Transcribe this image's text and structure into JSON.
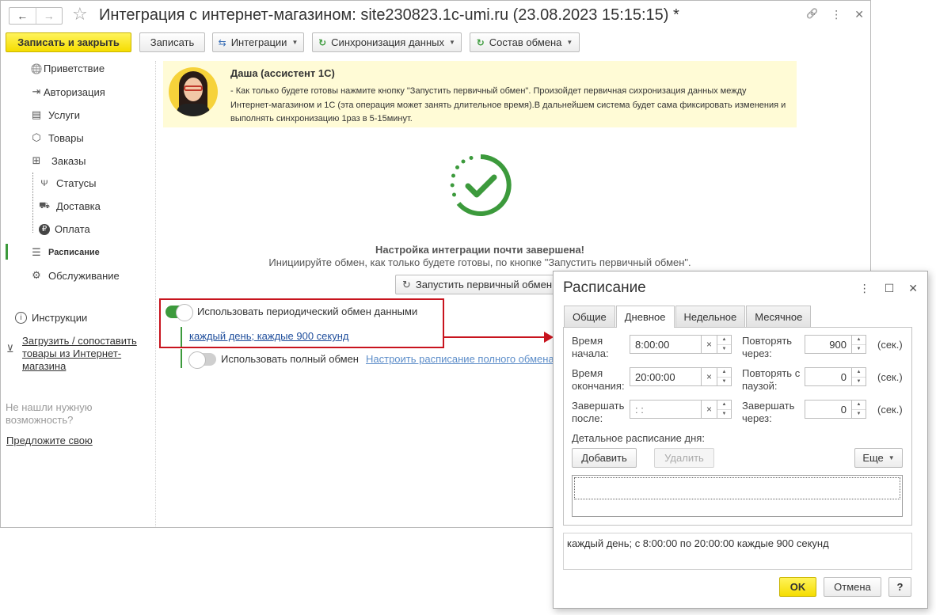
{
  "window": {
    "title": "Интеграция с интернет-магазином: site230823.1c-umi.ru (23.08.2023 15:15:15) *",
    "back_glyph": "←",
    "forward_glyph": "→",
    "star_glyph": "☆",
    "link_glyph": "🔗",
    "more_glyph": "⋮",
    "close_glyph": "✕"
  },
  "toolbar": {
    "save_close": "Записать и закрыть",
    "save": "Записать",
    "integrations": "Интеграции",
    "sync": "Синхронизация данных",
    "exchange_composition": "Состав обмена"
  },
  "sidebar": {
    "items": [
      {
        "label": "Приветствие",
        "icon": "globe-icon",
        "glyph": "🌐"
      },
      {
        "label": "Авторизация",
        "icon": "login-icon",
        "glyph": "⇥"
      },
      {
        "label": "Услуги",
        "icon": "services-icon",
        "glyph": "▤"
      },
      {
        "label": "Товары",
        "icon": "box-icon",
        "glyph": "⬡"
      },
      {
        "label": "Заказы",
        "icon": "basket-icon",
        "glyph": "⊞"
      },
      {
        "label": "Статусы",
        "icon": "status-icon",
        "glyph": "Ψ"
      },
      {
        "label": "Доставка",
        "icon": "delivery-icon",
        "glyph": "⛟"
      },
      {
        "label": "Оплата",
        "icon": "ruble-icon",
        "glyph": "₽"
      },
      {
        "label": "Расписание",
        "icon": "schedule-icon",
        "glyph": "☰"
      },
      {
        "label": "Обслуживание",
        "icon": "gear-icon",
        "glyph": "⚙"
      }
    ],
    "instructions": "Инструкции",
    "upload_link": "Загрузить / сопоставить товары из Интернет-магазина",
    "not_found": "Не нашли нужную возможность?",
    "suggest": "Предложите свою"
  },
  "assistant": {
    "name": "Даша (ассистент 1С)",
    "text": "- Как только будете готовы нажмите кнопку \"Запустить первичный обмен\". Произойдет первичная сихронизация данных между Интернет-магазином и 1С (эта операция может занять длительное время).В дальнейшем система будет сама фиксировать изменения и выполнять синхронизацию 1раз в 5-15минут."
  },
  "status": {
    "title": "Настройка интеграции почти завершена!",
    "subtitle": "Инициируйте обмен, как только будете готовы, по кнопке \"Запустить первичный обмен\".",
    "start_button": "Запустить первичный обмен"
  },
  "periodic": {
    "label": "Использовать периодический обмен данными",
    "enabled": true,
    "schedule_link": "каждый день; каждые 900 секунд"
  },
  "full_exchange": {
    "label": "Использовать полный обмен",
    "enabled": false,
    "schedule_link": "Настроить расписание полного обмена"
  },
  "dialog": {
    "title": "Расписание",
    "tabs": [
      "Общие",
      "Дневное",
      "Недельное",
      "Месячное"
    ],
    "active_tab": "Дневное",
    "start_time_label": "Время начала:",
    "start_time": "8:00:00",
    "end_time_label": "Время окончания:",
    "end_time": "20:00:00",
    "finish_after_label": "Завершать после:",
    "finish_after": " :  :",
    "repeat_every_label": "Повторять через:",
    "repeat_every": "900",
    "repeat_pause_label": "Повторять с паузой:",
    "repeat_pause": "0",
    "finish_in_label": "Завершать через:",
    "finish_in": "0",
    "unit": "(сек.)",
    "detail_label": "Детальное расписание дня:",
    "add": "Добавить",
    "delete": "Удалить",
    "more": "Еще",
    "summary": "каждый день; с 8:00:00 по 20:00:00 каждые 900 секунд",
    "ok": "OK",
    "cancel": "Отмена",
    "help": "?"
  },
  "colors": {
    "primary_button": "#f5dd00",
    "accent_green": "#3c9a3c",
    "highlight_red": "#c8141e",
    "assistant_bg": "#fffbd6",
    "link_blue": "#1f4e9c"
  }
}
